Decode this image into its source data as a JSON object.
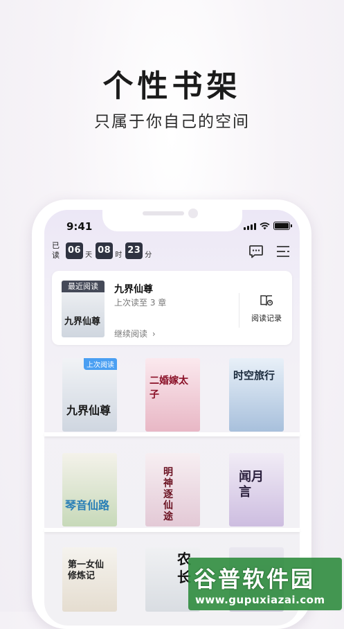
{
  "headline": "个性书架",
  "subline": "只属于你自己的空间",
  "status_bar": {
    "time": "9:41"
  },
  "reading_timer": {
    "label": "已读",
    "hours": "06",
    "hours_unit": "天",
    "minutes": "08",
    "minutes_unit": "时",
    "seconds": "23",
    "seconds_unit": "分"
  },
  "top_icons": [
    "message-icon",
    "list-menu-icon"
  ],
  "recent": {
    "tag": "最近阅读",
    "book_title": "九界仙尊",
    "progress": "上次读至 3 章",
    "continue": "继续阅读",
    "continue_arrow": "›",
    "history_label": "阅读记录",
    "cover_text": "九界仙尊"
  },
  "books": [
    {
      "cover_text": "九界仙尊",
      "badge": "上次阅读",
      "colors": [
        "#f1f3f6",
        "#cfd6e0"
      ],
      "text_color": "#1a1a1a"
    },
    {
      "cover_text": "二婚嫁太子",
      "badge": "",
      "colors": [
        "#fbe9ee",
        "#e8b7c5"
      ],
      "text_color": "#8a1027"
    },
    {
      "cover_text": "时空旅行",
      "badge": "",
      "colors": [
        "#e8f0f8",
        "#a8c0dc"
      ],
      "text_color": "#1a2a3c"
    },
    {
      "cover_text": "琴音仙路",
      "badge": "",
      "colors": [
        "#f4f2ea",
        "#c7d9b9"
      ],
      "text_color": "#2a7fb6"
    },
    {
      "cover_text": "明神逐仙途",
      "badge": "",
      "colors": [
        "#f7eff2",
        "#e3c9d6"
      ],
      "text_color": "#6a1020"
    },
    {
      "cover_text": "闻月言",
      "badge": "",
      "colors": [
        "#f1ecf6",
        "#cdbde0"
      ],
      "text_color": "#2a1f3c"
    },
    {
      "cover_text": "第一女仙修炼记",
      "badge": "",
      "colors": [
        "#f5f3ee",
        "#e5ddd0"
      ],
      "text_color": "#222222"
    },
    {
      "cover_text": "农长",
      "badge": "",
      "colors": [
        "#f0f1f3",
        "#d9dde2"
      ],
      "text_color": "#111111"
    },
    {
      "cover_text": "",
      "badge": "",
      "colors": [
        "#eae8f0",
        "#cfcadc"
      ],
      "text_color": "#222222"
    }
  ],
  "watermark": {
    "text": "谷普软件园",
    "url": "www.gupuxiazai.com"
  }
}
